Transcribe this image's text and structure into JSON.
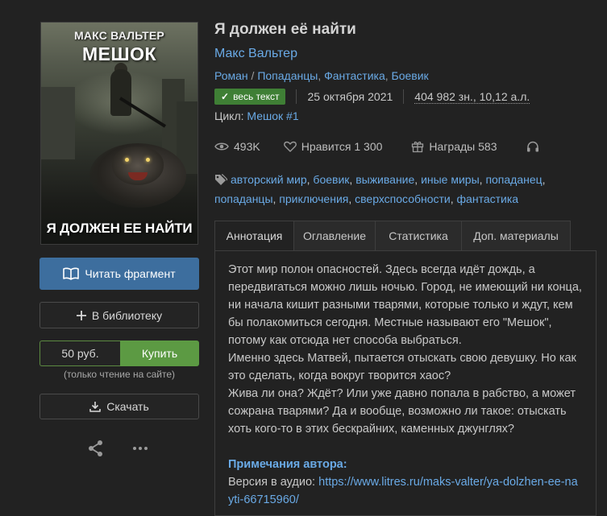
{
  "book": {
    "title": "Я должен её найти",
    "author": "Макс Вальтер",
    "genres": [
      "Роман",
      "Попаданцы",
      "Фантастика",
      "Боевик"
    ],
    "badge": "весь текст",
    "date": "25 октября 2021",
    "volume": "404 982 зн., 10,12 а.л.",
    "cycle_label": "Цикл:",
    "cycle": "Мешок #1"
  },
  "cover": {
    "author": "МАКС ВАЛЬТЕР",
    "series": "МЕШОК",
    "title": "Я ДОЛЖЕН ЕЕ НАЙТИ"
  },
  "stats": {
    "views": "493K",
    "likes_label": "Нравится",
    "likes": "1 300",
    "awards_label": "Награды",
    "awards": "583"
  },
  "tags": [
    "авторский мир",
    "боевик",
    "выживание",
    "иные миры",
    "попаданец",
    "попаданцы",
    "приключения",
    "сверхспособности",
    "фантастика"
  ],
  "actions": {
    "read": "Читать фрагмент",
    "library": "В библиотеку",
    "price": "50 руб.",
    "buy": "Купить",
    "buy_note": "(только чтение на сайте)",
    "download": "Скачать"
  },
  "tabs": [
    "Аннотация",
    "Оглавление",
    "Статистика",
    "Доп. материалы"
  ],
  "annotation": {
    "paragraphs": [
      "Этот мир полон опасностей. Здесь всегда идёт дождь, а передвигаться можно лишь ночью. Город, не имеющий ни конца, ни начала кишит разными тварями, которые только и ждут, кем бы полакомиться сегодня. Местные называют его \"Мешок\", потому как отсюда нет способа выбраться.",
      "Именно здесь Матвей, пытается отыскать свою девушку. Но как это сделать, когда вокруг творится хаос?",
      "Жива ли она? Ждёт? Или уже давно попала в рабство, а может сожрана тварями? Да и вообще, возможно ли такое: отыскать хоть кого-то в этих бескрайних, каменных джунглях?"
    ],
    "notes_heading": "Примечания автора:",
    "audio_label": "Версия в аудио:",
    "audio_link": "https://www.litres.ru/maks-valter/ya-dolzhen-ee-nayti-66715960/"
  },
  "colors": {
    "background": "#222222",
    "accent": "#6aaae6",
    "read_button": "#3d6e9e",
    "buy_button": "#5c9a43",
    "badge": "#3f7f35"
  }
}
